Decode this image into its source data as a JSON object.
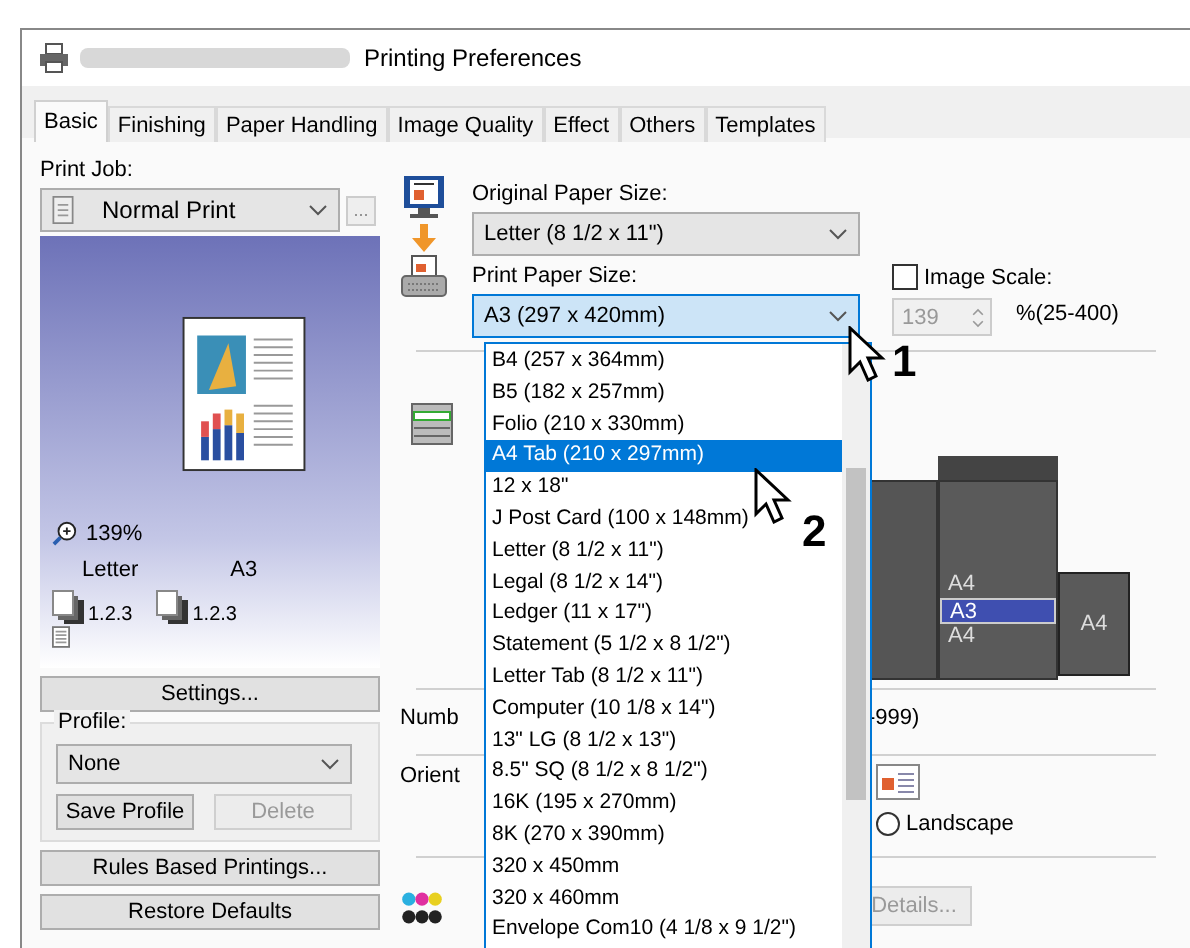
{
  "window": {
    "title": "Printing Preferences"
  },
  "tabs": [
    {
      "label": "Basic",
      "selected": true
    },
    {
      "label": "Finishing",
      "selected": false
    },
    {
      "label": "Paper Handling",
      "selected": false
    },
    {
      "label": "Image Quality",
      "selected": false
    },
    {
      "label": "Effect",
      "selected": false
    },
    {
      "label": "Others",
      "selected": false
    },
    {
      "label": "Templates",
      "selected": false
    }
  ],
  "print_job": {
    "label": "Print Job:",
    "value": "Normal Print",
    "more": "..."
  },
  "preview": {
    "zoom": "139%",
    "original": "Letter",
    "output": "A3",
    "collate_original": "1.2.3",
    "collate_output": "1.2.3"
  },
  "settings_button": "Settings...",
  "profile": {
    "label": "Profile:",
    "value": "None",
    "save": "Save Profile",
    "delete": {
      "label": "Delete",
      "disabled": true
    }
  },
  "rules_button": "Rules Based Printings...",
  "restore_button": "Restore Defaults",
  "original_paper_size": {
    "label": "Original Paper Size:",
    "value": "Letter (8 1/2 x 11\")"
  },
  "print_paper_size": {
    "label": "Print Paper Size:",
    "value": "A3 (297 x 420mm)",
    "expanded": true,
    "options": [
      {
        "label": "B4 (257 x 364mm)",
        "selected": false
      },
      {
        "label": "B5 (182 x 257mm)",
        "selected": false
      },
      {
        "label": "Folio (210 x 330mm)",
        "selected": false
      },
      {
        "label": "A4 Tab (210 x 297mm)",
        "selected": true
      },
      {
        "label": "12 x 18\"",
        "selected": false
      },
      {
        "label": "J Post Card (100 x 148mm)",
        "selected": false
      },
      {
        "label": "Letter (8 1/2 x 11\")",
        "selected": false
      },
      {
        "label": "Legal (8 1/2 x 14\")",
        "selected": false
      },
      {
        "label": "Ledger (11 x 17\")",
        "selected": false
      },
      {
        "label": "Statement (5 1/2 x 8 1/2\")",
        "selected": false
      },
      {
        "label": "Letter Tab (8 1/2 x 11\")",
        "selected": false
      },
      {
        "label": "Computer (10 1/8 x 14\")",
        "selected": false
      },
      {
        "label": "13\" LG (8 1/2 x 13\")",
        "selected": false
      },
      {
        "label": "8.5\" SQ (8 1/2 x 8 1/2\")",
        "selected": false
      },
      {
        "label": "16K (195 x 270mm)",
        "selected": false
      },
      {
        "label": "8K (270 x 390mm)",
        "selected": false
      },
      {
        "label": "320 x 450mm",
        "selected": false
      },
      {
        "label": "320 x 460mm",
        "selected": false
      },
      {
        "label": "Envelope Com10 (4 1/8 x 9 1/2\")",
        "selected": false
      }
    ]
  },
  "image_scale": {
    "label": "Image Scale:",
    "checked": false,
    "value": "139",
    "range": "%(25-400)"
  },
  "trays": [
    {
      "label": "A4",
      "selected": false
    },
    {
      "label": "A3",
      "selected": true
    },
    {
      "label": "A4",
      "selected": false
    }
  ],
  "side_tray": "A4",
  "copies": {
    "label": "Numb",
    "range": "-999)"
  },
  "orientation": {
    "label": "Orient",
    "landscape": {
      "label": "Landscape",
      "selected": false
    }
  },
  "details_button": {
    "label": "Details...",
    "disabled": true
  },
  "callouts": [
    "1",
    "2"
  ]
}
